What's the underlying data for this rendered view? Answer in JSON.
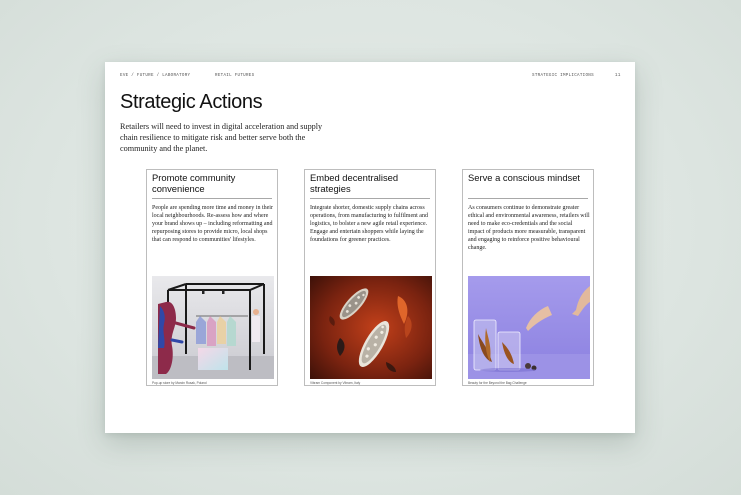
{
  "header": {
    "left": "EVE / FUTURE / LABORATORY",
    "center": "RETAIL FUTURES",
    "section": "STRATEGIC IMPLICATIONS",
    "page_number": "11"
  },
  "title": "Strategic Actions",
  "intro": "Retailers will need to invest in digital acceleration and supply chain resilience to mitigate risk and better serve both the community and the planet.",
  "cards": [
    {
      "title": "Promote community convenience",
      "body": "People are spending more time and money in their local neighbourhoods. Re-assess how and where your brand shows up – including reformatting and repurposing stores to provide micro, local shops that can respond to communities' lifestyles.",
      "caption": "Pop-up store by Marcin Rusak, Poland"
    },
    {
      "title": "Embed decentralised strategies",
      "body": "Integrate shorter, domestic supply chains across operations, from manufacturing to fulfilment and logistics, to bolster a new agile retail experience. Engage and entertain shoppers while laying the foundations for greener practices.",
      "caption": "Vibram Component by Vibram, Italy"
    },
    {
      "title": "Serve a conscious mindset",
      "body": "As consumers continue to demonstrate greater ethical and environmental awareness, retailers will need to make eco-credentials and the social impact of products more measurable, transparent and engaging to reinforce positive behavioural change.",
      "caption": "Beauty for the Beyond the Bag Challenge"
    }
  ]
}
